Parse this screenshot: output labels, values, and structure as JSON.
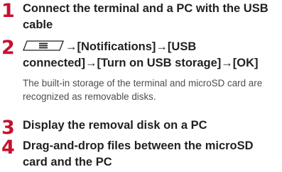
{
  "steps": [
    {
      "number": "1",
      "title": "Connect the terminal and a PC with the USB cable"
    },
    {
      "number": "2",
      "key_icon": "menu-key-icon",
      "title_after_key": "→[Notifications]→[USB connected]→[Turn on USB storage]→[OK]",
      "description": "The built-in storage of the terminal and microSD card are recognized as removable disks."
    },
    {
      "number": "3",
      "title": "Display the removal disk on a PC"
    },
    {
      "number": "4",
      "title": "Drag-and-drop files between the microSD card and the PC"
    }
  ],
  "colors": {
    "step_number": "#c8102e",
    "title_text": "#231f20",
    "description_text": "#4d4d4f"
  }
}
